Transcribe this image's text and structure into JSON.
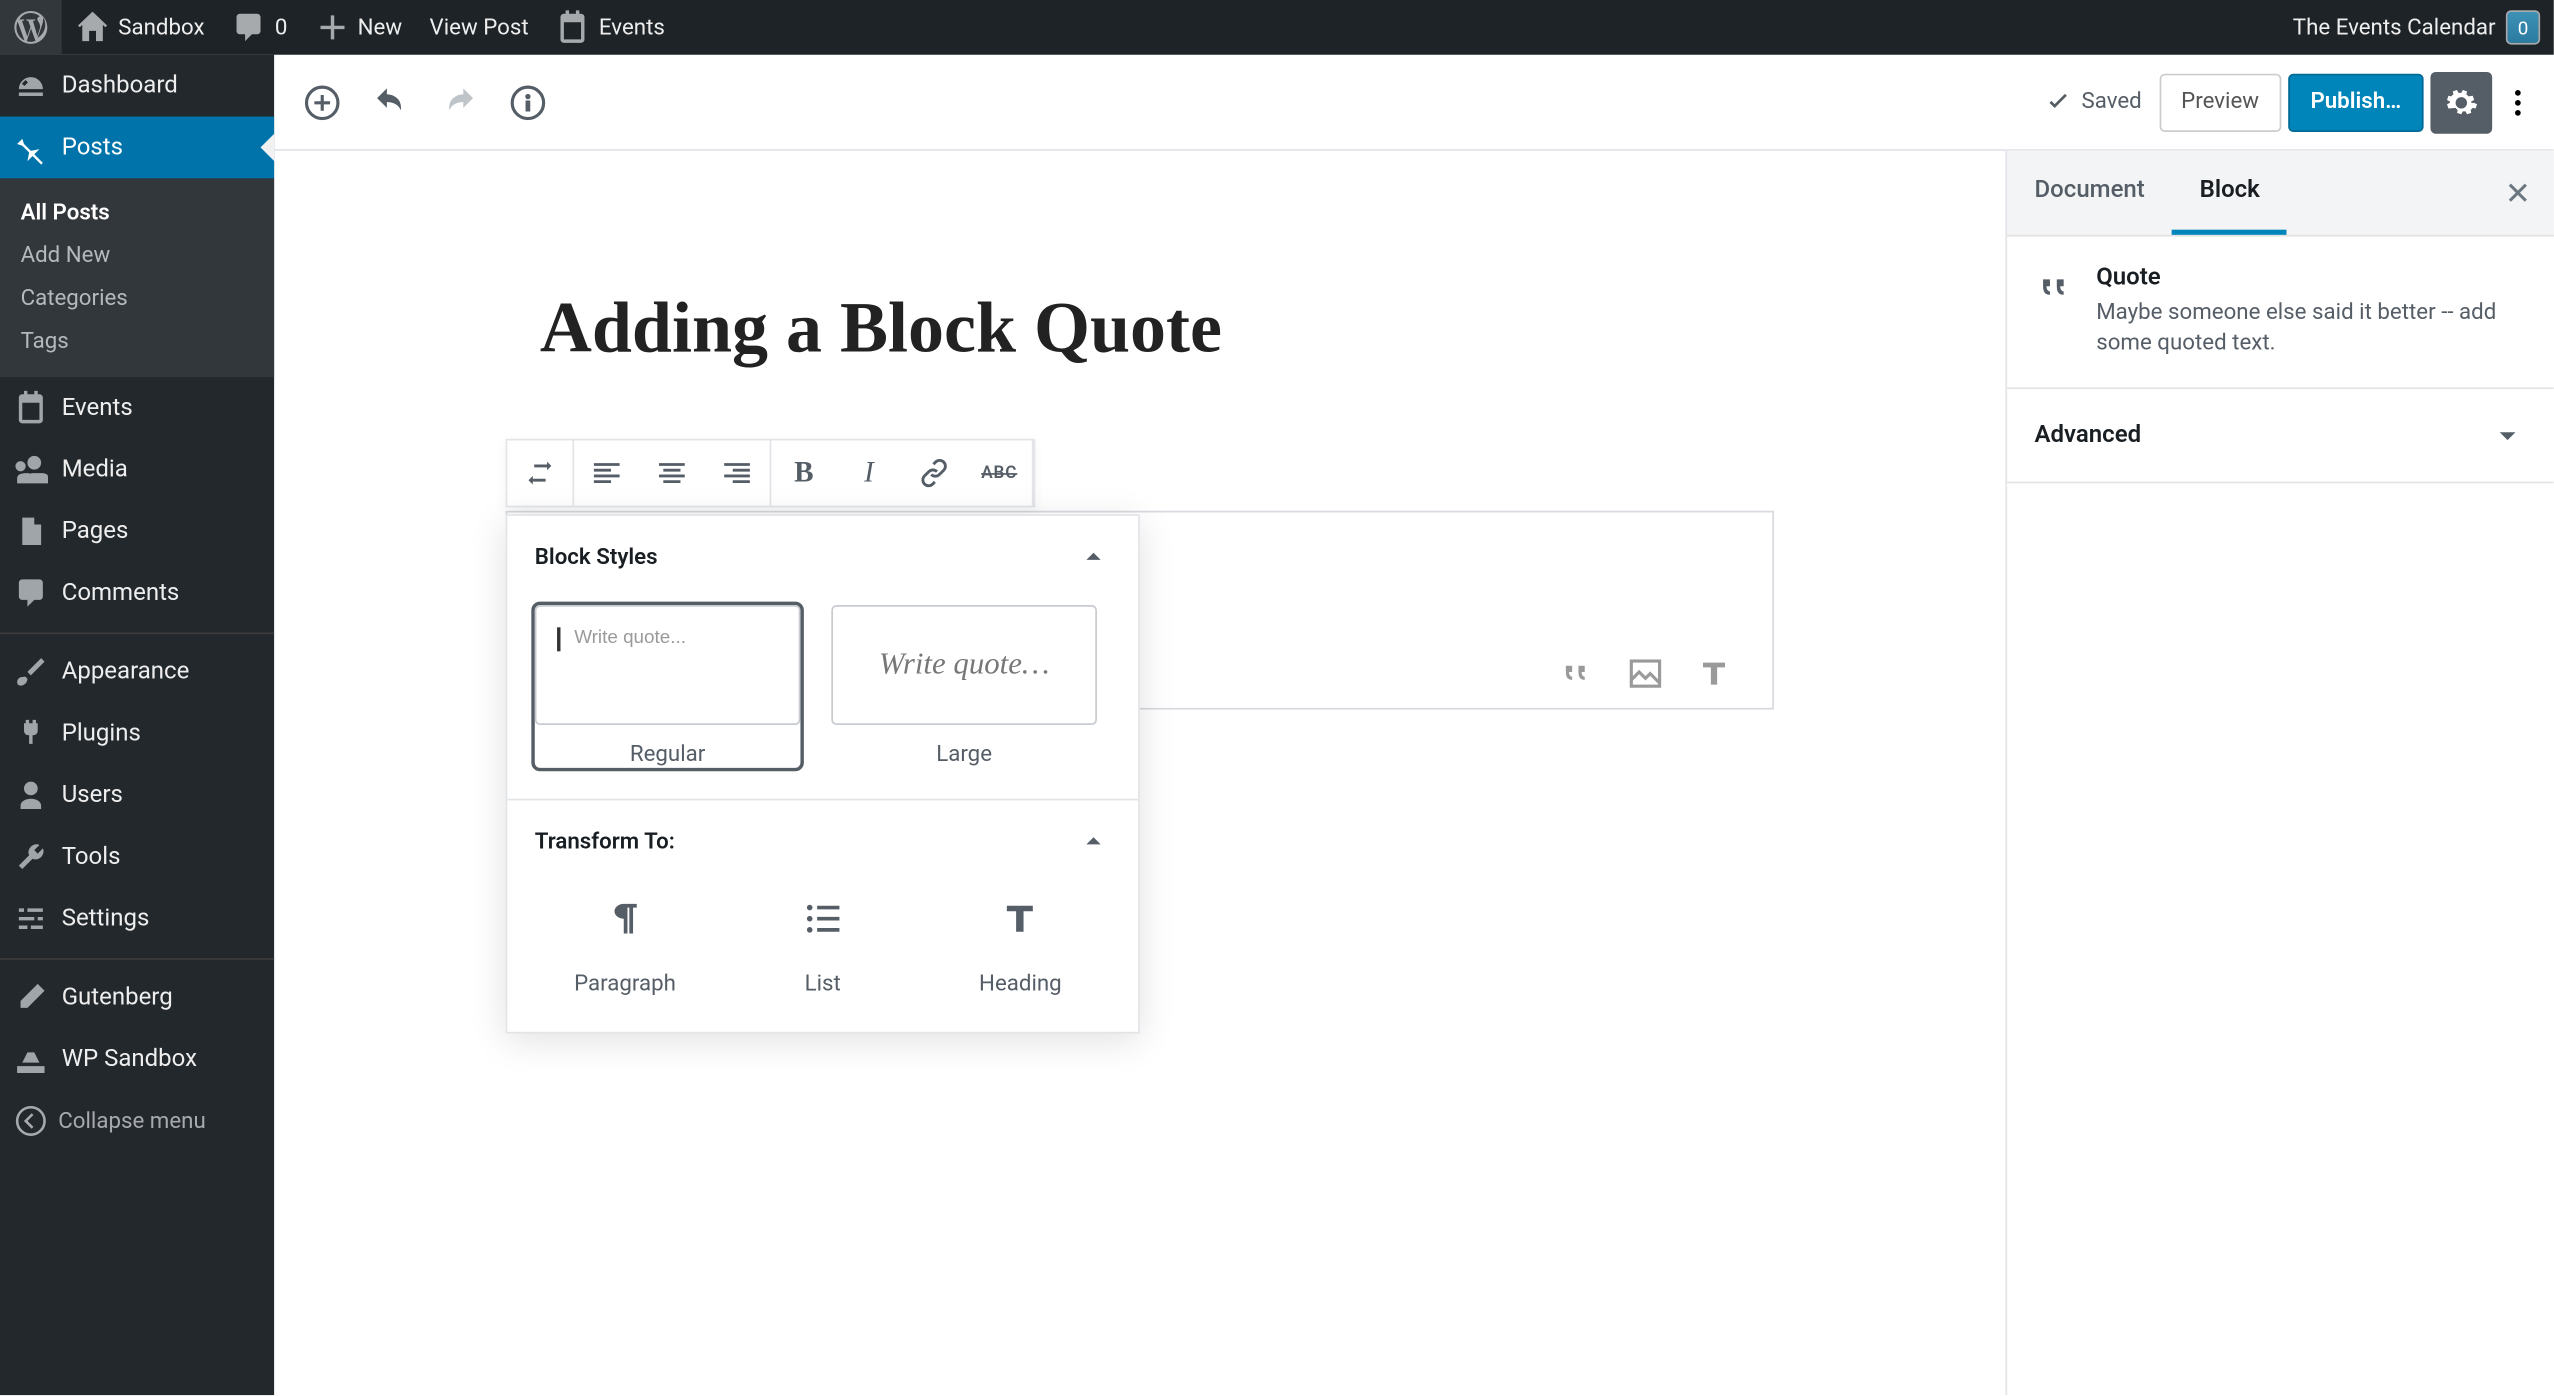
{
  "adminbar": {
    "site_name": "Sandbox",
    "comments": "0",
    "new": "New",
    "view_post": "View Post",
    "events": "Events",
    "right_plugin": "The Events Calendar",
    "cal_badge": "0"
  },
  "sidebar": {
    "dashboard": "Dashboard",
    "posts": "Posts",
    "posts_sub": {
      "all": "All Posts",
      "add": "Add New",
      "cats": "Categories",
      "tags": "Tags"
    },
    "events": "Events",
    "media": "Media",
    "pages": "Pages",
    "comments": "Comments",
    "appearance": "Appearance",
    "plugins": "Plugins",
    "users": "Users",
    "tools": "Tools",
    "settings": "Settings",
    "gutenberg": "Gutenberg",
    "wpsandbox": "WP Sandbox",
    "collapse": "Collapse menu"
  },
  "editor_top": {
    "saved": "Saved",
    "preview": "Preview",
    "publish": "Publish…"
  },
  "post": {
    "title": "Adding a Block Quote"
  },
  "toolbar": {
    "abc": "ABC"
  },
  "popover": {
    "styles_head": "Block Styles",
    "style_regular_ph": "Write quote...",
    "style_regular": "Regular",
    "style_large_preview": "Write quote…",
    "style_large": "Large",
    "transform_head": "Transform To:",
    "tf_paragraph": "Paragraph",
    "tf_list": "List",
    "tf_heading": "Heading"
  },
  "inspector": {
    "tab_document": "Document",
    "tab_block": "Block",
    "block_title": "Quote",
    "block_desc": "Maybe someone else said it better -- add some quoted text.",
    "advanced": "Advanced"
  }
}
